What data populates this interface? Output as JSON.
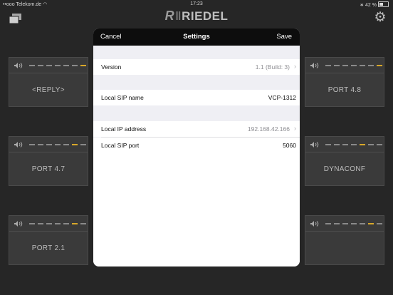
{
  "status_bar": {
    "carrier": "••ooo Telekom.de",
    "wifi": "wifi-icon",
    "time": "17:23",
    "bluetooth": "bluetooth-icon",
    "battery_pct": "42 %"
  },
  "header": {
    "logo_mark": "R",
    "logo_text": "RIEDEL"
  },
  "keys": [
    {
      "label": "<REPLY>"
    },
    {
      "label": "PORT 4.8"
    },
    {
      "label": "PORT 4.7"
    },
    {
      "label": "DYNACONF"
    },
    {
      "label": "PORT 2.1"
    },
    {
      "label": ""
    }
  ],
  "modal": {
    "cancel": "Cancel",
    "title": "Settings",
    "save": "Save",
    "rows": {
      "version": {
        "label": "Version",
        "value": "1.1 (Build: 3)"
      },
      "sip_name": {
        "label": "Local SIP name",
        "value": "VCP-1312"
      },
      "ip": {
        "label": "Local IP address",
        "value": "192.168.42.166"
      },
      "sip_port": {
        "label": "Local SIP port",
        "value": "5060"
      }
    }
  },
  "colors": {
    "background": "#262626",
    "key": "#3a3a3a",
    "meter_lit": "#d8a82a",
    "nav": "#0d0d0d",
    "group_bg": "#efeff4"
  }
}
